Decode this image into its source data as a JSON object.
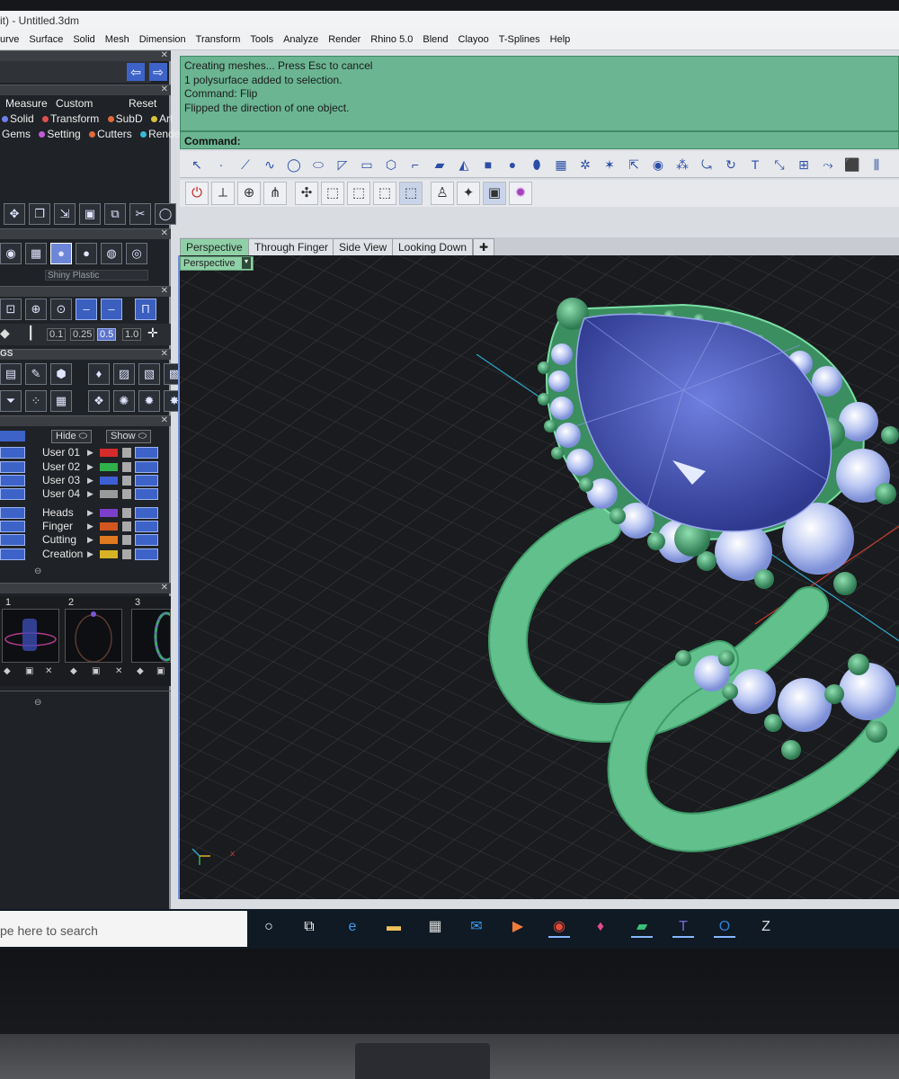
{
  "window": {
    "title": "it) - Untitled.3dm"
  },
  "menu": [
    "urve",
    "Surface",
    "Solid",
    "Mesh",
    "Dimension",
    "Transform",
    "Tools",
    "Analyze",
    "Render",
    "Rhino 5.0",
    "Blend",
    "Clayoo",
    "T-Splines",
    "Help"
  ],
  "matrix_tabs": {
    "row1": [
      "Measure",
      "Custom",
      "Reset"
    ],
    "row2": [
      "Solid",
      "Transform",
      "SubD",
      "Art"
    ],
    "row3": [
      "Gems",
      "Setting",
      "Cutters",
      "Render"
    ]
  },
  "material": {
    "name": "Shiny Plastic"
  },
  "values": [
    "0.1",
    "0.25",
    "0.5",
    "1.0"
  ],
  "section_label": "GS",
  "layers": {
    "hide_label": "Hide",
    "show_label": "Show",
    "items": [
      {
        "name": "User 01",
        "color": "#d62b2b"
      },
      {
        "name": "User 02",
        "color": "#2fb24a"
      },
      {
        "name": "User 03",
        "color": "#3c5fd4"
      },
      {
        "name": "User 04",
        "color": "#9a9a9a"
      },
      {
        "name": "Heads",
        "color": "#7b3fc9"
      },
      {
        "name": "Finger",
        "color": "#d2561f"
      },
      {
        "name": "Cutting",
        "color": "#df7a1f"
      },
      {
        "name": "Creation",
        "color": "#d8b224"
      }
    ]
  },
  "thumbnails": [
    "1",
    "2",
    "3"
  ],
  "command": {
    "history": [
      "Creating meshes... Press Esc to cancel",
      "1 polysurface added to selection.",
      "Command: Flip",
      "Flipped the direction of one object."
    ],
    "prompt": "Command:"
  },
  "viewport_tabs": [
    "Perspective",
    "Through Finger",
    "Side View",
    "Looking Down"
  ],
  "active_viewport": "Perspective",
  "taskbar": {
    "search_placeholder": "pe here to search"
  },
  "colors": {
    "command_bg": "#6bb592",
    "viewport_bg": "#1a1b1e",
    "accent": "#3d63c9",
    "model_green": "#4fbf86",
    "gem_blue": "#4b5fc0"
  }
}
